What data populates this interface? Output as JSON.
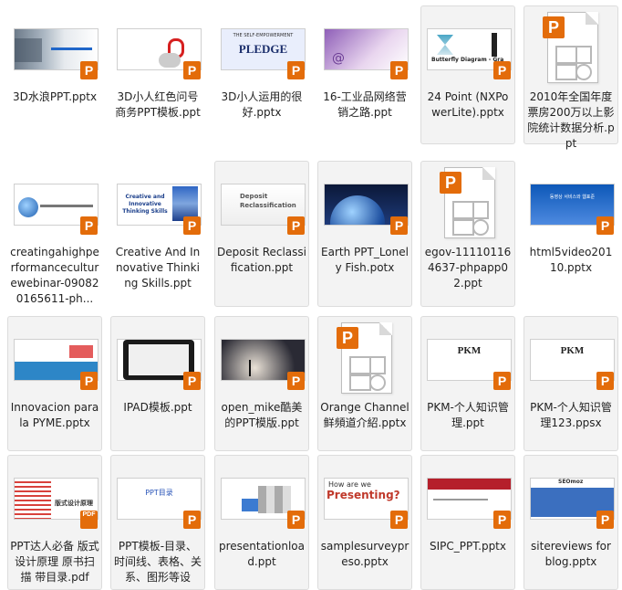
{
  "files": [
    {
      "name": "3D水浪PPT.pptx",
      "kind": "slide",
      "theme": "wave",
      "badge": "P",
      "sel": false
    },
    {
      "name": "3D小人红色问号商务PPT模板.ppt",
      "kind": "slide",
      "theme": "question",
      "badge": "P",
      "sel": false
    },
    {
      "name": "3D小人运用的很好.pptx",
      "kind": "slide",
      "theme": "pledge",
      "badge": "P",
      "sel": false,
      "thumb_text": "PLEDGE",
      "thumb_sub": "THE SELF-EMPOWERMENT"
    },
    {
      "name": "16-工业品网络营销之路.ppt",
      "kind": "slide",
      "theme": "purple",
      "badge": "P",
      "sel": false
    },
    {
      "name": "24 Point (NXPowerLite).pptx",
      "kind": "slide",
      "theme": "butterfly",
      "badge": "P",
      "sel": true,
      "thumb_text": "Butterfly Diagram - Gra"
    },
    {
      "name": "2010年全国年度票房200万以上影院统计数据分析.ppt",
      "kind": "doc",
      "badge": "P",
      "sel": true
    },
    {
      "name": "creatingahighperformanceculturewebinar-090820165611-ph...",
      "kind": "slide",
      "theme": "creating",
      "badge": "P",
      "sel": false
    },
    {
      "name": "Creative And Innovative Thinking Skills.ppt",
      "kind": "slide",
      "theme": "creative",
      "badge": "P",
      "sel": false,
      "thumb_text": "Creative and Innovative Thinking Skills"
    },
    {
      "name": "Deposit Reclassification.ppt",
      "kind": "slide",
      "theme": "deposit",
      "badge": "P",
      "sel": true,
      "thumb_text": "Deposit Reclassification"
    },
    {
      "name": "Earth PPT_Lonely Fish.potx",
      "kind": "slide",
      "theme": "earth",
      "badge": "P",
      "sel": true
    },
    {
      "name": "egov-111101164637-phpapp02.ppt",
      "kind": "doc",
      "badge": "P",
      "sel": true
    },
    {
      "name": "html5video20110.pptx",
      "kind": "slide",
      "theme": "html5",
      "badge": "P",
      "sel": false
    },
    {
      "name": "Innovacion para la PYME.pptx",
      "kind": "slide",
      "theme": "innov",
      "badge": "P",
      "sel": true
    },
    {
      "name": "IPAD模板.ppt",
      "kind": "slide",
      "theme": "ipad",
      "badge": "P",
      "sel": true
    },
    {
      "name": "open_mike酷美的PPT模版.ppt",
      "kind": "slide",
      "theme": "mike",
      "badge": "P",
      "sel": true
    },
    {
      "name": "Orange Channel鲜頻道介紹.pptx",
      "kind": "doc",
      "badge": "P",
      "sel": true
    },
    {
      "name": "PKM-个人知识管理.ppt",
      "kind": "slide",
      "theme": "pkm",
      "badge": "P",
      "sel": true,
      "thumb_text": "PKM"
    },
    {
      "name": "PKM-个人知识管理123.ppsx",
      "kind": "slide",
      "theme": "pkm",
      "badge": "P",
      "sel": true,
      "thumb_text": "PKM"
    },
    {
      "name": "PPT达人必备 版式设计原理 原书扫描 带目录.pdf",
      "kind": "pdf",
      "theme": "book",
      "badge": "PDF",
      "sel": true,
      "thumb_text": "版式设计原理"
    },
    {
      "name": "PPT模板-目录、时间线、表格、关系、图形等设",
      "kind": "slide",
      "theme": "pptmenu",
      "badge": "P",
      "sel": true,
      "thumb_text": "PPT目录"
    },
    {
      "name": "presentationload.ppt",
      "kind": "slide",
      "theme": "puzzle",
      "badge": "P",
      "sel": true
    },
    {
      "name": "samplesurveypreso.pptx",
      "kind": "slide",
      "theme": "survey",
      "badge": "P",
      "sel": true,
      "thumb_text": "Presenting?",
      "thumb_sub": "How are we"
    },
    {
      "name": "SIPC_PPT.pptx",
      "kind": "slide",
      "theme": "sipc",
      "badge": "P",
      "sel": true
    },
    {
      "name": "sitereviews for blog.pptx",
      "kind": "slide",
      "theme": "seomoz",
      "badge": "P",
      "sel": true,
      "thumb_text": "SEOmoz"
    }
  ]
}
